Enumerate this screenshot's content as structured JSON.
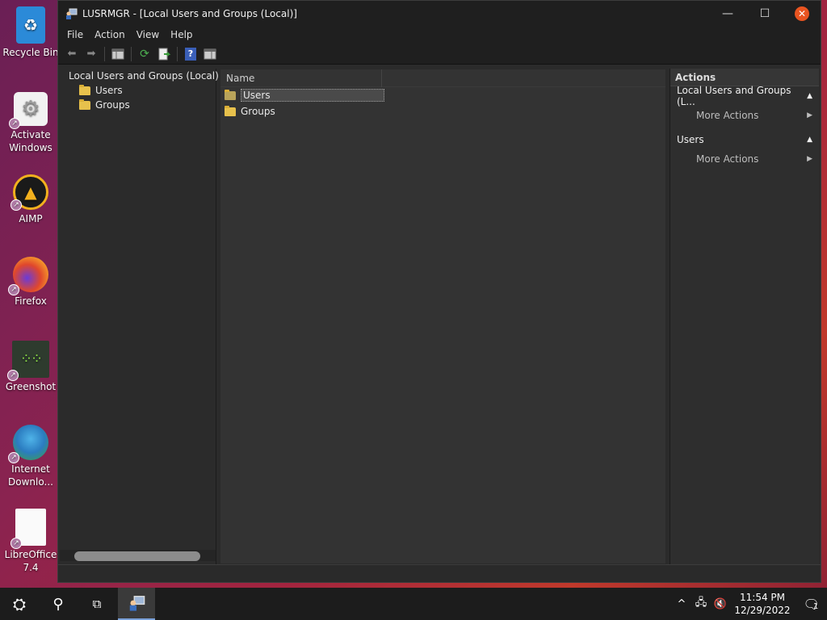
{
  "desktop": {
    "icons": [
      {
        "label": "Recycle Bin",
        "icon": "recycle-bin-icon"
      },
      {
        "label": "Activate Windows",
        "icon": "settings-gear-icon"
      },
      {
        "label": "AIMP",
        "icon": "aimp-icon"
      },
      {
        "label": "Firefox",
        "icon": "firefox-icon"
      },
      {
        "label": "Greenshot",
        "icon": "greenshot-icon"
      },
      {
        "label": "Internet Downlo...",
        "icon": "internet-download-manager-icon"
      },
      {
        "label": "LibreOffice 7.4",
        "icon": "libreoffice-icon"
      }
    ]
  },
  "window": {
    "title": "LUSRMGR - [Local Users and Groups (Local)]",
    "controls": {
      "minimize": "—",
      "maximize": "☐",
      "close": "✕"
    },
    "menu": [
      "File",
      "Action",
      "View",
      "Help"
    ],
    "tree": {
      "root": "Local Users and Groups (Local)",
      "children": [
        "Users",
        "Groups"
      ]
    },
    "list": {
      "column_name": "Name",
      "rows": [
        "Users",
        "Groups"
      ],
      "selected_index": 0
    },
    "actions": {
      "header": "Actions",
      "sections": [
        {
          "title": "Local Users and Groups (L...",
          "sub": "More Actions"
        },
        {
          "title": "Users",
          "sub": "More Actions"
        }
      ]
    }
  },
  "taskbar": {
    "time": "11:54 PM",
    "date": "12/29/2022",
    "notification_count": "1"
  },
  "colors": {
    "accent": "#e95420",
    "folder": "#e7c14c",
    "window_bg": "#2b2b2b"
  }
}
